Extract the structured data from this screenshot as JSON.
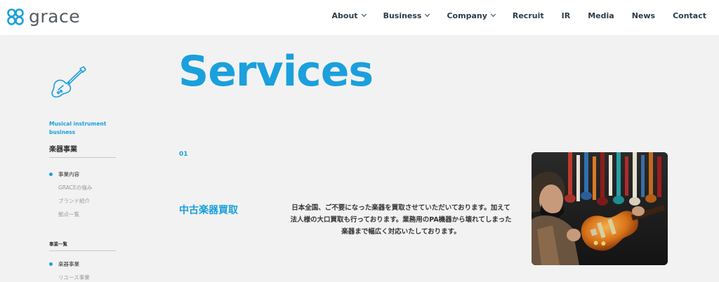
{
  "header": {
    "logo_text": "grace",
    "nav": [
      {
        "label": "About",
        "dropdown": true
      },
      {
        "label": "Business",
        "dropdown": true
      },
      {
        "label": "Company",
        "dropdown": true
      },
      {
        "label": "Recruit",
        "dropdown": false
      },
      {
        "label": "IR",
        "dropdown": false
      },
      {
        "label": "Media",
        "dropdown": false
      },
      {
        "label": "News",
        "dropdown": false
      },
      {
        "label": "Contact",
        "dropdown": false
      }
    ]
  },
  "sidebar": {
    "icon": "guitar-icon",
    "category_en": "Musical instrument business",
    "category_title": "楽器事業",
    "items": [
      {
        "label": "事業内容",
        "active": true
      },
      {
        "label": "GRACEの強み",
        "active": false
      },
      {
        "label": "ブランド紹介",
        "active": false
      },
      {
        "label": "拠点一覧",
        "active": false
      }
    ],
    "section_label": "事業一覧",
    "business_items": [
      {
        "label": "楽器事業",
        "active": true
      },
      {
        "label": "リユース事業",
        "active": false
      }
    ]
  },
  "main": {
    "title": "Services",
    "service": {
      "number": "01",
      "name": "中古楽器買取",
      "description_lines": [
        "日本全国、ご不要になった楽器を買取させていただいております。加えて",
        "法人様の大口買取も行っております。業務用のPA機器から壊れてしまった",
        "楽器まで幅広く対応いたしております。"
      ],
      "photo": "guitar-photo"
    }
  },
  "colors": {
    "accent": "#1aa0dc",
    "nav_text": "#2b3a4a",
    "background": "#f2f2f2",
    "header_bg": "#ffffff"
  }
}
